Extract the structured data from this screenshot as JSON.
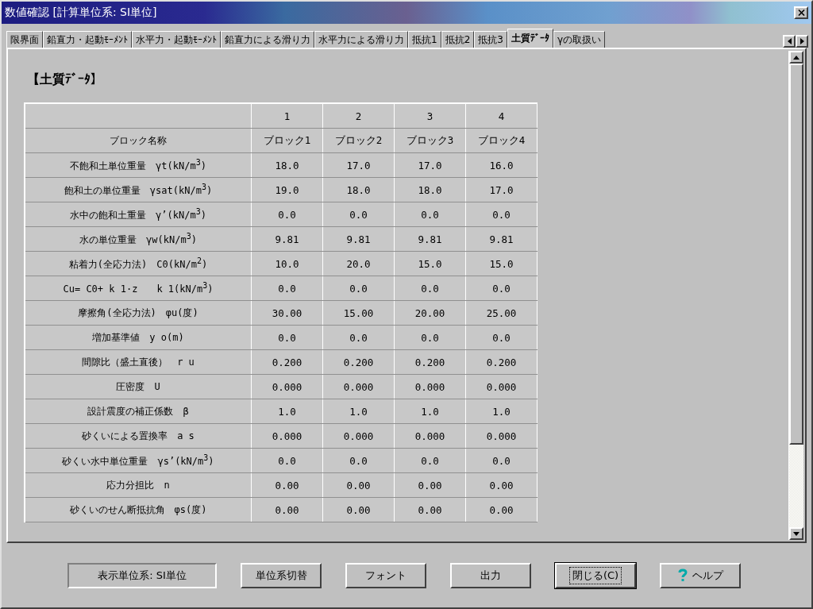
{
  "window": {
    "title": "数値確認 [計算単位系: SI単位]"
  },
  "tabs": [
    {
      "label": "限界面",
      "selected": false
    },
    {
      "label": "鉛直力・起動ﾓｰﾒﾝﾄ",
      "selected": false
    },
    {
      "label": "水平力・起動ﾓｰﾒﾝﾄ",
      "selected": false
    },
    {
      "label": "鉛直力による滑り力",
      "selected": false
    },
    {
      "label": "水平力による滑り力",
      "selected": false
    },
    {
      "label": "抵抗1",
      "selected": false
    },
    {
      "label": "抵抗2",
      "selected": false
    },
    {
      "label": "抵抗3",
      "selected": false
    },
    {
      "label": "土質ﾃﾞｰﾀ",
      "selected": true
    },
    {
      "label": "γの取扱い",
      "selected": false
    }
  ],
  "section_title": "【土質ﾃﾞｰﾀ】",
  "table": {
    "columns": [
      "1",
      "2",
      "3",
      "4"
    ],
    "rows": [
      {
        "label": "ブロック名称",
        "values": [
          "ブロック1",
          "ブロック2",
          "ブロック3",
          "ブロック4"
        ]
      },
      {
        "label": "不飽和土単位重量　γt(kN/m$^{3}$)",
        "values": [
          "18.0",
          "17.0",
          "17.0",
          "16.0"
        ]
      },
      {
        "label": "飽和土の単位重量　γsat(kN/m$^{3}$)",
        "values": [
          "19.0",
          "18.0",
          "18.0",
          "17.0"
        ]
      },
      {
        "label": "水中の飽和土重量　γ’(kN/m$^{3}$)",
        "values": [
          "0.0",
          "0.0",
          "0.0",
          "0.0"
        ]
      },
      {
        "label": "水の単位重量　γw(kN/m$^{3}$)",
        "values": [
          "9.81",
          "9.81",
          "9.81",
          "9.81"
        ]
      },
      {
        "label": "粘着力(全応力法)　C0(kN/m$^{2}$)",
        "values": [
          "10.0",
          "20.0",
          "15.0",
          "15.0"
        ]
      },
      {
        "label": "Cu= C0+ k 1·z　　k 1(kN/m$^{3}$)",
        "values": [
          "0.0",
          "0.0",
          "0.0",
          "0.0"
        ]
      },
      {
        "label": "摩擦角(全応力法)　φu(度)",
        "values": [
          "30.00",
          "15.00",
          "20.00",
          "25.00"
        ]
      },
      {
        "label": "増加基準値　y o(m)",
        "values": [
          "0.0",
          "0.0",
          "0.0",
          "0.0"
        ]
      },
      {
        "label": "間隙比（盛土直後）　r u",
        "values": [
          "0.200",
          "0.200",
          "0.200",
          "0.200"
        ]
      },
      {
        "label": "圧密度　U",
        "values": [
          "0.000",
          "0.000",
          "0.000",
          "0.000"
        ]
      },
      {
        "label": "設計震度の補正係数　β",
        "values": [
          "1.0",
          "1.0",
          "1.0",
          "1.0"
        ]
      },
      {
        "label": "砂くいによる置換率　a s",
        "values": [
          "0.000",
          "0.000",
          "0.000",
          "0.000"
        ]
      },
      {
        "label": "砂くい水中単位重量　γs’(kN/m$^{3}$)",
        "values": [
          "0.0",
          "0.0",
          "0.0",
          "0.0"
        ]
      },
      {
        "label": "応力分担比　n",
        "values": [
          "0.00",
          "0.00",
          "0.00",
          "0.00"
        ]
      },
      {
        "label": "砂くいのせん断抵抗角　φs(度)",
        "values": [
          "0.00",
          "0.00",
          "0.00",
          "0.00"
        ]
      }
    ]
  },
  "buttons": [
    {
      "label": "表示単位系: SI単位",
      "kind": "status"
    },
    {
      "label": "単位系切替",
      "kind": "plain"
    },
    {
      "label": "フォント",
      "kind": "plain"
    },
    {
      "label": "出力",
      "kind": "plain"
    },
    {
      "label": "閉じる(C)",
      "kind": "focused"
    },
    {
      "label": "ヘルプ",
      "kind": "help"
    }
  ]
}
